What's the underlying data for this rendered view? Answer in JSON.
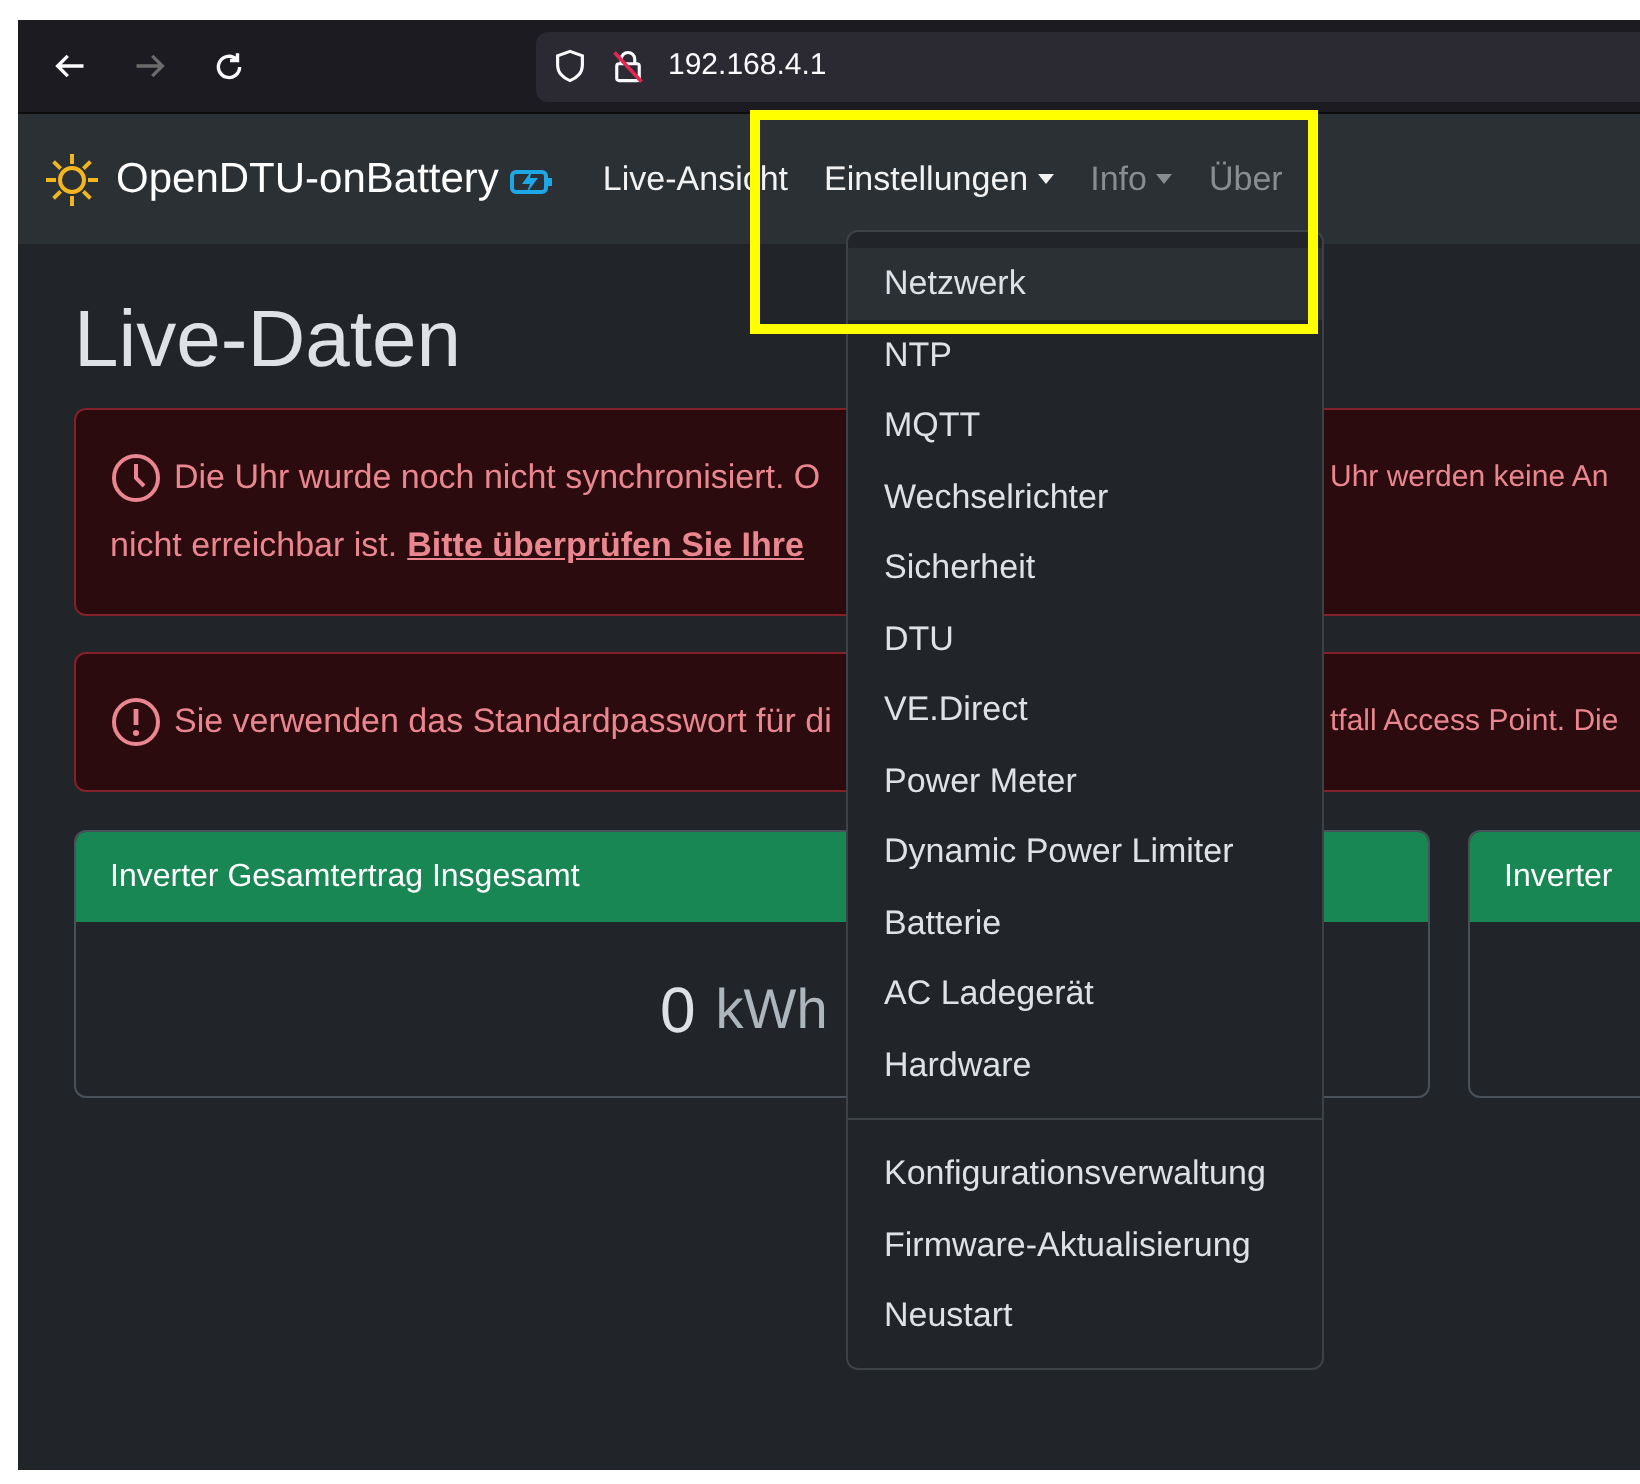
{
  "browser": {
    "back": {
      "disabled": false
    },
    "forward": {
      "disabled": true
    },
    "url": "192.168.4.1"
  },
  "navbar": {
    "brand": "OpenDTU-onBattery",
    "items": [
      {
        "label": "Live-Ansicht",
        "dropdown": false,
        "selected": true
      },
      {
        "label": "Einstellungen",
        "dropdown": true,
        "selected": true
      },
      {
        "label": "Info",
        "dropdown": true,
        "selected": false
      },
      {
        "label": "Über",
        "dropdown": false,
        "selected": false
      }
    ]
  },
  "menu": {
    "groups": [
      [
        {
          "label": "Netzwerk",
          "selected": true
        },
        {
          "label": "NTP",
          "selected": false
        },
        {
          "label": "MQTT",
          "selected": false
        },
        {
          "label": "Wechselrichter",
          "selected": false
        },
        {
          "label": "Sicherheit",
          "selected": false
        },
        {
          "label": "DTU",
          "selected": false
        },
        {
          "label": "VE.Direct",
          "selected": false
        },
        {
          "label": "Power Meter",
          "selected": false
        },
        {
          "label": "Dynamic Power Limiter",
          "selected": false
        },
        {
          "label": "Batterie",
          "selected": false
        },
        {
          "label": "AC Ladegerät",
          "selected": false
        },
        {
          "label": "Hardware",
          "selected": false
        }
      ],
      [
        {
          "label": "Konfigurationsverwaltung",
          "selected": false
        },
        {
          "label": "Firmware-Aktualisierung",
          "selected": false
        },
        {
          "label": "Neustart",
          "selected": false
        }
      ]
    ]
  },
  "page_title": "Live-Daten",
  "alerts": [
    {
      "kind": "clock",
      "lines": [
        {
          "left": "Die Uhr wurde noch nicht synchronisiert. O",
          "right": "Uhr werden keine An"
        },
        {
          "left": "nicht erreichbar ist.",
          "link": "Bitte überprüfen Sie Ihre"
        }
      ]
    },
    {
      "kind": "warning",
      "lines": [
        {
          "left": "Sie verwenden das Standardpasswort für di",
          "right": "tfall Access Point. Die"
        }
      ]
    }
  ],
  "cards": [
    {
      "title": "Inverter Gesamtertrag Insgesamt",
      "value": "0",
      "unit": "kWh"
    },
    {
      "title": "Inverter"
    }
  ]
}
